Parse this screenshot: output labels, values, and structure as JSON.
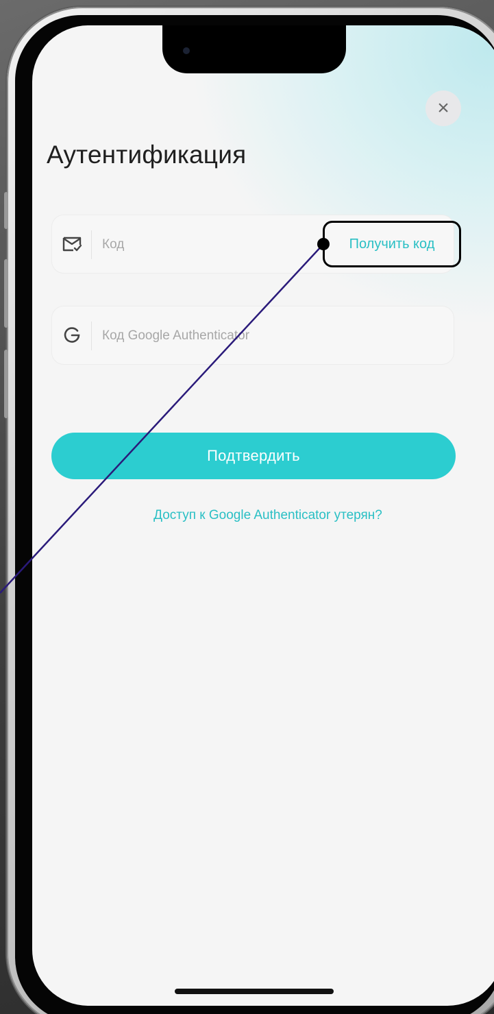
{
  "screen": {
    "title": "Аутентификация",
    "close_icon_glyph": "×"
  },
  "email_field": {
    "icon": "mail-check-icon",
    "placeholder": "Код",
    "action_label": "Получить код"
  },
  "ga_field": {
    "icon": "google-g-icon",
    "placeholder": "Код Google Authenticator"
  },
  "confirm_button": {
    "label": "Подтвердить"
  },
  "lost_access_link": {
    "label": "Доступ к Google Authenticator утерян?"
  },
  "colors": {
    "accent": "#2ccdd0",
    "link": "#29bfc4",
    "background": "#f5f5f5",
    "annotation_line": "#2a1a7a"
  }
}
